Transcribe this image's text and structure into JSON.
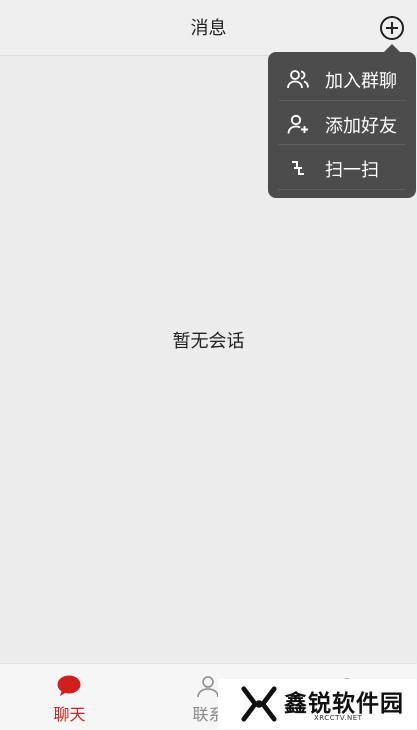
{
  "header": {
    "title": "消息"
  },
  "menu": {
    "items": [
      {
        "label": "加入群聊",
        "icon": "group-icon"
      },
      {
        "label": "添加好友",
        "icon": "add-user-icon"
      },
      {
        "label": "扫一扫",
        "icon": "scan-icon"
      }
    ]
  },
  "main": {
    "empty_text": "暂无会话"
  },
  "tabbar": {
    "tabs": [
      {
        "label": "聊天",
        "icon": "chat-icon",
        "active": true
      },
      {
        "label": "联系",
        "icon": "contacts-icon",
        "active": false
      }
    ]
  },
  "watermark": {
    "title": "鑫锐软件园",
    "subtitle": "XRCCTV.NET"
  },
  "colors": {
    "accent": "#d0201e",
    "popup_bg": "#4c4c4c",
    "background": "#ececec"
  }
}
